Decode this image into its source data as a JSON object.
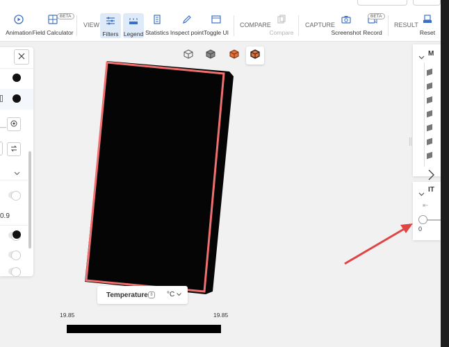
{
  "toolbar": {
    "items": [
      {
        "label": "Animation",
        "icon": "play-circle-icon"
      },
      {
        "label": "Field Calculator",
        "icon": "calculator-icon",
        "badge": "BETA"
      },
      {
        "label": "Filters",
        "icon": "sliders-icon",
        "active": true
      },
      {
        "label": "Legend",
        "icon": "legend-icon",
        "active": true
      },
      {
        "label": "Statistics",
        "icon": "statistics-icon"
      },
      {
        "label": "Inspect point",
        "icon": "pen-icon"
      },
      {
        "label": "Toggle UI",
        "icon": "window-icon"
      },
      {
        "label": "Compare",
        "icon": "compare-icon",
        "disabled": true
      },
      {
        "label": "Screenshot",
        "icon": "camera-icon"
      },
      {
        "label": "Record",
        "icon": "record-icon",
        "badge": "BETA"
      },
      {
        "label": "Reset",
        "icon": "reset-icon"
      }
    ],
    "sections": {
      "view": "VIEW",
      "compare": "COMPARE",
      "capture": "CAPTURE",
      "result": "RESULT"
    }
  },
  "left_panel": {
    "partial_value": "0.9"
  },
  "viewport": {
    "view_buttons": [
      "cube-outline-icon",
      "cube-solid-icon",
      "cube-orange-icon",
      "cube-orange-outline-icon"
    ]
  },
  "legend": {
    "title": "Temperature",
    "info_icon": "8",
    "unit": "°C",
    "min_label": "19.85",
    "max_label": "19.85",
    "colorbar_color": "#000000"
  },
  "right_panel": {
    "section_1_title": "M",
    "section_2_title": "IT",
    "slider_value": "0",
    "slider_position": 0
  },
  "annotation": {
    "arrow_color": "#e04444"
  }
}
